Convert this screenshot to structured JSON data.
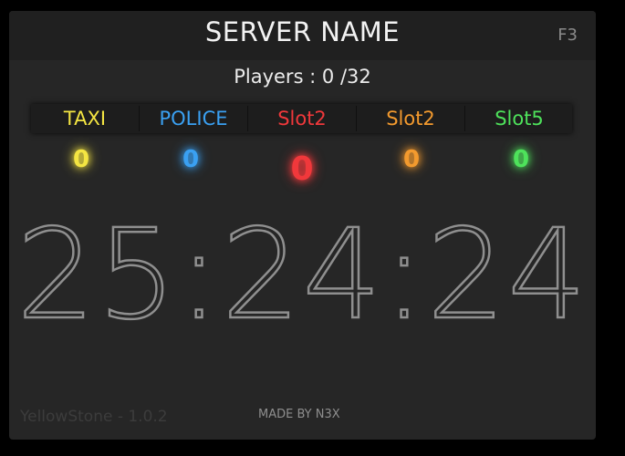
{
  "header": {
    "server_name": "SERVER NAME",
    "hotkey": "F3"
  },
  "players": {
    "label": "Players : 0  /32"
  },
  "teams": [
    {
      "name": "TAXI",
      "score": "0",
      "color": "#f4e542"
    },
    {
      "name": "POLICE",
      "score": "0",
      "color": "#3aa0f2"
    },
    {
      "name": "Slot2",
      "score": "0",
      "color": "#f0383b"
    },
    {
      "name": "Slot2",
      "score": "0",
      "color": "#f39a2e"
    },
    {
      "name": "Slot5",
      "score": "0",
      "color": "#4ee25b"
    }
  ],
  "timer": {
    "value": "25:24:24"
  },
  "footer": {
    "version": "YellowStone - 1.0.2",
    "credit": "MADE BY N3X"
  }
}
